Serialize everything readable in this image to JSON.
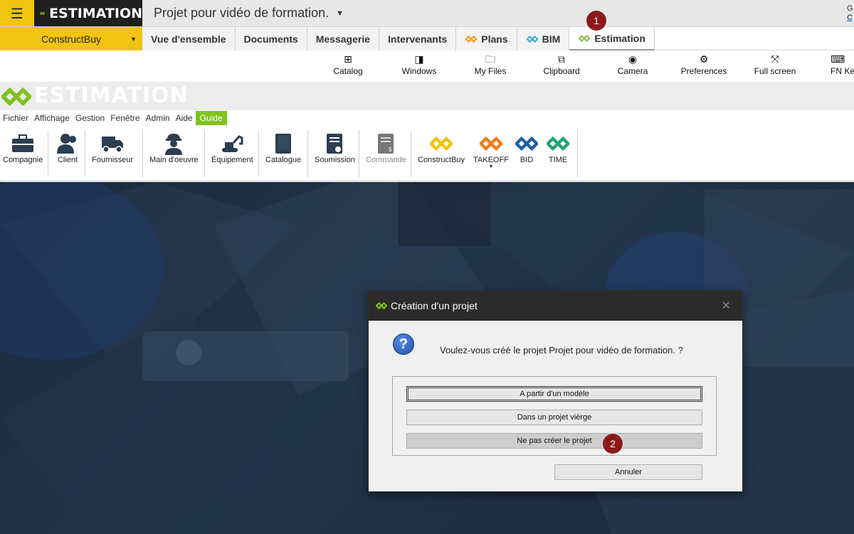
{
  "topbar": {
    "brand": "ESTIMATION",
    "project_title": "Projet pour vidéo de formation.",
    "right_text_1": "G",
    "right_text_2": "C"
  },
  "company": {
    "name": "ConstructBuy"
  },
  "tabs": [
    {
      "label": "Vue d'ensemble"
    },
    {
      "label": "Documents"
    },
    {
      "label": "Messagerie"
    },
    {
      "label": "Intervenants"
    },
    {
      "label": "Plans",
      "icon": "orange-logo-icon"
    },
    {
      "label": "BIM",
      "icon": "blue-logo-icon"
    },
    {
      "label": "Estimation",
      "icon": "green-logo-icon",
      "active": true
    }
  ],
  "viewer_toolbar": [
    {
      "label": "Catalog",
      "icon": "plus-box-icon"
    },
    {
      "label": "Windows",
      "icon": "window-icon"
    },
    {
      "label": "My Files",
      "icon": "folder-icon"
    },
    {
      "label": "Clipboard",
      "icon": "clipboard-icon"
    },
    {
      "label": "Camera",
      "icon": "camera-icon"
    },
    {
      "label": "Preferences",
      "icon": "gear-icon"
    },
    {
      "label": "Full screen",
      "icon": "fullscreen-icon"
    },
    {
      "label": "FN Ke",
      "icon": "keyboard-icon"
    }
  ],
  "app": {
    "banner": "ESTIMATION"
  },
  "menu": [
    "Fichier",
    "Affichage",
    "Gestion",
    "Fenêtre",
    "Admin",
    "Aide",
    "Guide"
  ],
  "ribbon": [
    {
      "label": "Compagnie",
      "icon": "briefcase-icon"
    },
    {
      "label": "Client",
      "icon": "users-icon"
    },
    {
      "label": "Fournisseur",
      "icon": "truck-icon"
    },
    {
      "label": "Main d'oeuvre",
      "icon": "worker-icon"
    },
    {
      "label": "Équipement",
      "icon": "excavator-icon"
    },
    {
      "label": "Catalogue",
      "icon": "book-icon"
    },
    {
      "label": "Soumission",
      "icon": "document-check-icon"
    },
    {
      "label": "Commande",
      "icon": "document-dollar-icon",
      "disabled": true
    },
    {
      "label": "ConstructBuy",
      "icon": "yellow-logo-icon"
    },
    {
      "label": "TAKEOFF",
      "icon": "orange-logo-icon"
    },
    {
      "label": "BID",
      "icon": "blue-logo-icon"
    },
    {
      "label": "TIME",
      "icon": "green-logo-icon"
    }
  ],
  "dialog": {
    "title": "Création d'un projet",
    "message": "Voulez-vous créé le projet Projet pour vidéo de formation. ?",
    "buttons": {
      "model": "A partir d'un modèle",
      "blank": "Dans un projet vièrge",
      "skip": "Ne pas créer le projet",
      "cancel": "Annuler"
    }
  },
  "badges": {
    "one": "1",
    "two": "2"
  },
  "colors": {
    "accent_yellow": "#f1c40f",
    "brand_green": "#7fc31c",
    "dark": "#1f1f1f",
    "badge": "#8b1a1a"
  }
}
